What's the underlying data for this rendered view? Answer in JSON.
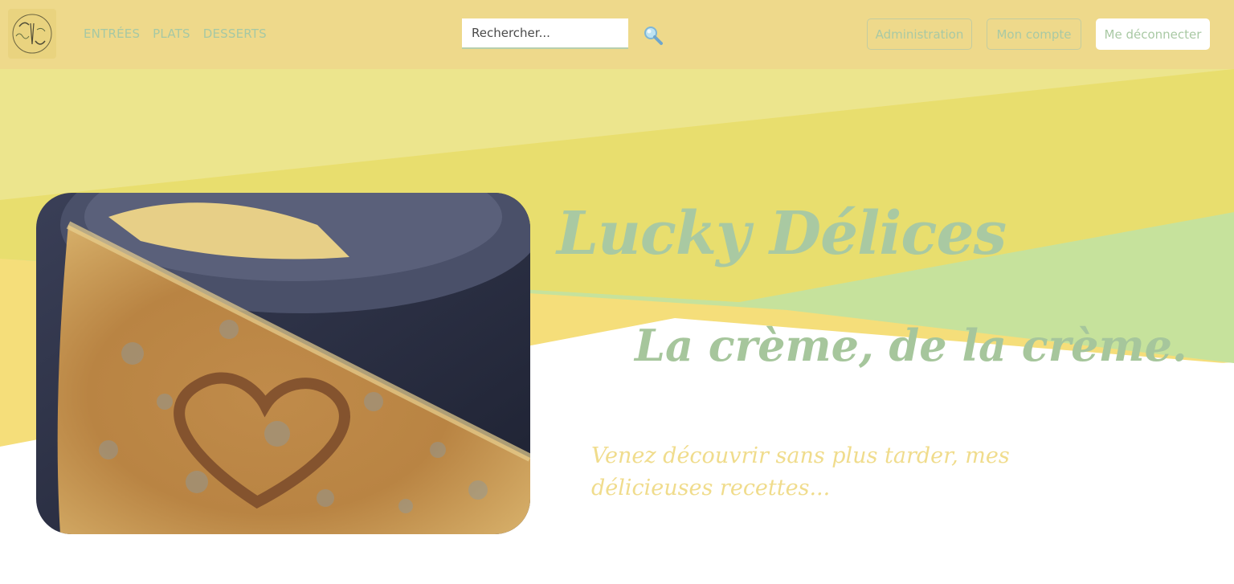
{
  "navbar": {
    "links": [
      "ENTRÉES",
      "PLATS",
      "DESSERTS"
    ],
    "search": {
      "placeholder": "Rechercher..."
    },
    "buttons": {
      "admin": "Administration",
      "account": "Mon compte",
      "logout": "Me déconnecter"
    },
    "icons": {
      "logo": "lucky-delices-logo",
      "search": "search-icon"
    }
  },
  "hero": {
    "title": "Lucky Délices",
    "tagline": "La crème, de la crème.",
    "intro": "Venez découvrir sans plus tarder, mes délicieuses recettes..."
  },
  "colors": {
    "navbar_bg": "#eed98b",
    "accent_green": "#a9c9a2",
    "accent_yellow": "#f0dc8c",
    "band_light_yellow": "#ece58d",
    "band_yellow": "#e8de6e",
    "band_green": "#c6e29c"
  }
}
